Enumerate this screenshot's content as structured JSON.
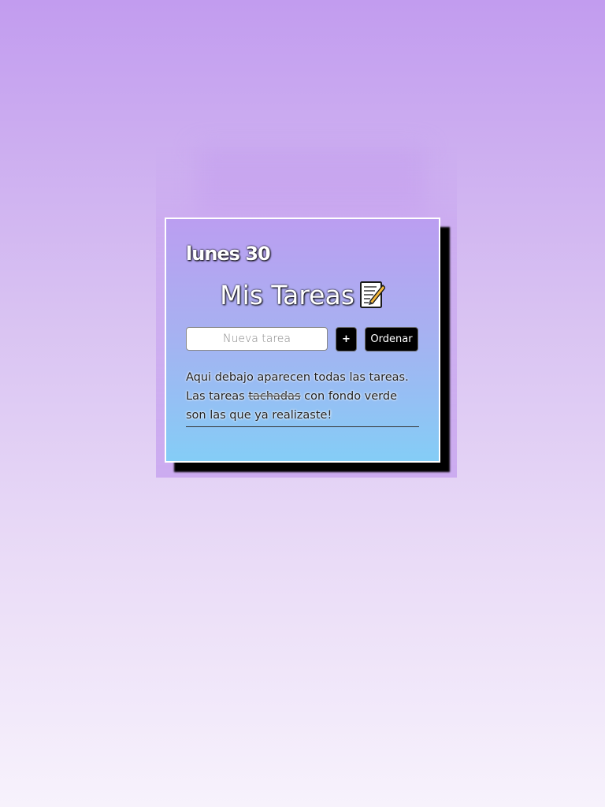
{
  "header": {
    "date": "lunes 30",
    "title": "Mis Tareas",
    "title_icon": "memo-icon"
  },
  "form": {
    "input_placeholder": "Nueva tarea",
    "input_value": "",
    "add_label": "+",
    "sort_label": "Ordenar"
  },
  "info": {
    "line1": "Aqui debajo aparecen todas las tareas.",
    "line2_before": "Las tareas ",
    "line2_strike": "tachadas",
    "line2_after": " con fondo verde son las que ya realizaste!"
  },
  "tasks": [],
  "colors": {
    "card_top": "#bb9ef1",
    "card_bottom": "#84cdf6",
    "button_bg": "#000000",
    "shadow": "#000000"
  }
}
